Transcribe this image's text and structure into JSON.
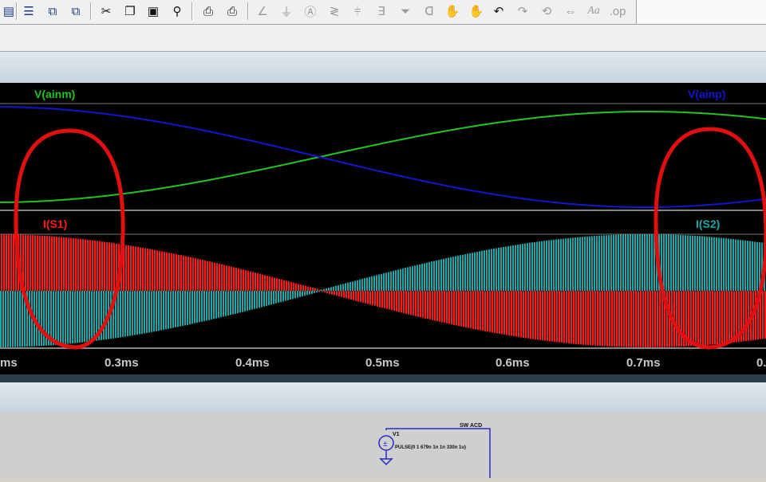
{
  "toolbar": {
    "icons": [
      "new-schematic-icon",
      "cascade-icon",
      "tile-icon",
      "cut-icon",
      "copy-icon",
      "paste-icon",
      "find-icon",
      "print-setup-icon",
      "print-icon",
      "wire-icon",
      "ground-icon",
      "label-icon",
      "resistor-icon",
      "capacitor-icon",
      "inductor-icon",
      "diode-icon",
      "component-icon",
      "move-icon",
      "drag-icon",
      "undo-icon",
      "redo-icon",
      "rotate-icon",
      "mirror-icon",
      "text-icon",
      "spice-directive-icon"
    ],
    "text_button": "Aa"
  },
  "plot": {
    "pane_top_traces": [
      {
        "label": "V(ainm)",
        "color": "#22c422"
      },
      {
        "label": "V(ainp)",
        "color": "#1515d0"
      }
    ],
    "pane_bottom_traces": [
      {
        "label": "I(S1)",
        "color": "#ff1a1a"
      },
      {
        "label": "I(S2)",
        "color": "#19a7a7"
      }
    ],
    "x_ticks": [
      "ms",
      "0.3ms",
      "0.4ms",
      "0.5ms",
      "0.6ms",
      "0.7ms",
      "0."
    ],
    "annotation_color": "#e01010"
  },
  "chart_data": {
    "type": "line",
    "x_unit": "ms",
    "xlim": [
      0.2,
      0.8
    ],
    "x_ticks": [
      "0.3ms",
      "0.4ms",
      "0.5ms",
      "0.6ms",
      "0.7ms"
    ],
    "series": [
      {
        "name": "V(ainm)",
        "color": "#22c422",
        "shape": "sine-peak-at-0.5ms"
      },
      {
        "name": "V(ainp)",
        "color": "#1515d0",
        "shape": "sine-trough-at-0.5ms"
      },
      {
        "name": "I(S1)",
        "color": "#ff1a1a",
        "shape": "switched-envelope-max-at-0.5ms"
      },
      {
        "name": "I(S2)",
        "color": "#19a7a7",
        "shape": "switched-envelope-max-at-0.5ms"
      }
    ],
    "crossings_ms": [
      0.25,
      0.75
    ]
  },
  "schematic": {
    "source_name": "V1",
    "source_value": "PULSE(0 1 679n 1n 1n 330n 1u)",
    "net_label": "SW ACD"
  }
}
